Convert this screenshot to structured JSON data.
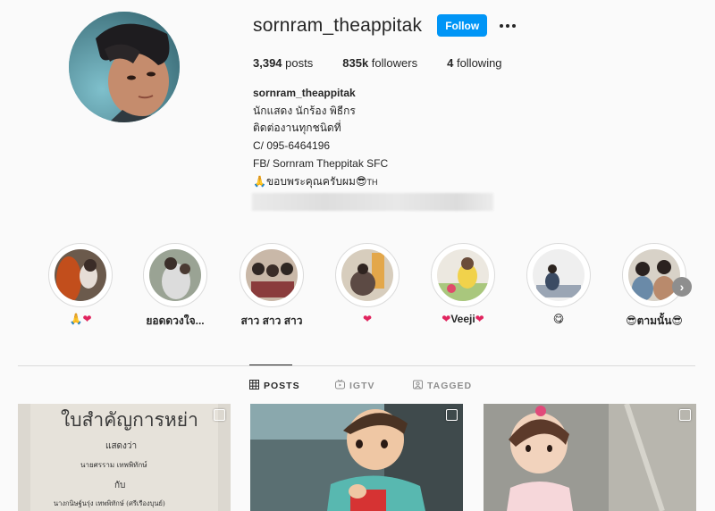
{
  "profile": {
    "username": "sornram_theappitak",
    "follow_label": "Follow",
    "more_icon": "ellipsis-icon"
  },
  "stats": {
    "posts_count": "3,394",
    "posts_label": "posts",
    "followers_count": "835k",
    "followers_label": "followers",
    "following_count": "4",
    "following_label": "following"
  },
  "bio": {
    "name": "sornram_theappitak",
    "lines": [
      "นักแสดง นักร้อง พิธีกร",
      "ติดต่องานทุกชนิดที่",
      "C/ 095-6464196",
      "FB/ Sornram Theppitak SFC",
      "🙏ขอบพระคุณครับผม😎",
      "TH"
    ]
  },
  "highlights": [
    {
      "label_a": "🙏",
      "label_b": "❤"
    },
    {
      "label_a": "ยอดดวงใจ...",
      "label_b": ""
    },
    {
      "label_a": "สาว สาว สาว",
      "label_b": ""
    },
    {
      "label_a": "",
      "label_b": "❤"
    },
    {
      "label_a": "Veeji",
      "label_b": "❤"
    },
    {
      "label_a": "😋",
      "label_b": ""
    },
    {
      "label_a": "😎ตามนั้น😎",
      "label_b": ""
    }
  ],
  "tabs": {
    "posts": "POSTS",
    "igtv": "IGTV",
    "tagged": "TAGGED"
  },
  "posts": {
    "doc_title": "ใบสำคัญการหย่า",
    "doc_line1": "แสดงว่า",
    "doc_line2": "นายศรราม เทพพิทักษ์",
    "doc_line3": "กับ",
    "doc_line4": "นางกนิษฐ์นรุ่ง เทพพิทักษ์ (ศรีเรืองบุนย์)"
  },
  "colors": {
    "accent": "#0095f6",
    "text": "#262626",
    "muted": "#8e8e8e",
    "background": "#fafafa",
    "border": "#dbdbdb"
  }
}
